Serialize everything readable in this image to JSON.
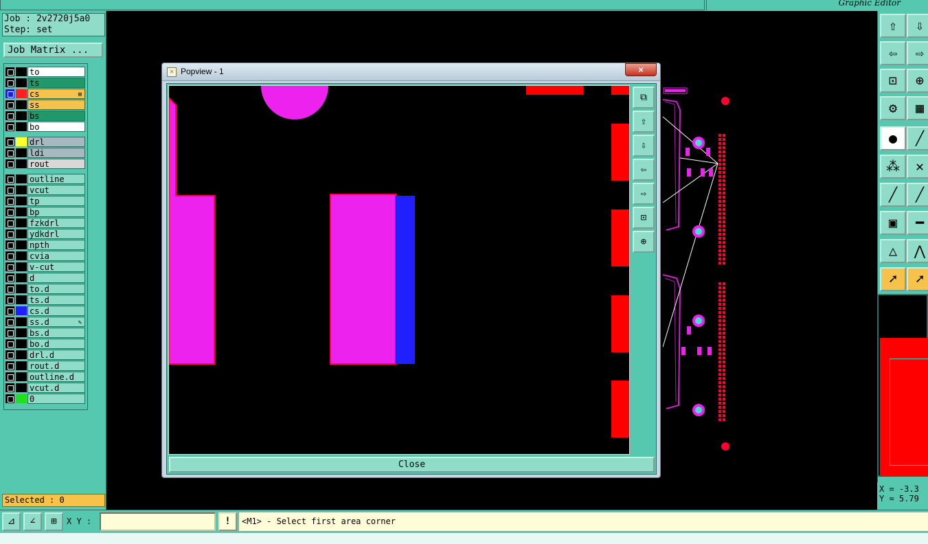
{
  "app": {
    "title": "Graphic Editor"
  },
  "job": {
    "name_line": "Job : 2v2720j5a0",
    "step_line": "Step: set",
    "matrix_button": "Job Matrix ..."
  },
  "layers": {
    "board": [
      {
        "name": "to",
        "swatch": "#000000",
        "bg": "#ffffff"
      },
      {
        "name": "ts",
        "swatch": "#000000",
        "bg": "#1e9a6a"
      },
      {
        "name": "cs",
        "swatch": "#ff2020",
        "bg": "#f7c24a",
        "selected": true,
        "mark": "⊞"
      },
      {
        "name": "ss",
        "swatch": "#000000",
        "bg": "#f7c24a"
      },
      {
        "name": "bs",
        "swatch": "#000000",
        "bg": "#1e9a6a"
      },
      {
        "name": "bo",
        "swatch": "#000000",
        "bg": "#ffffff"
      }
    ],
    "drill": [
      {
        "name": "drl",
        "swatch": "#ffff30",
        "bg": "#a8b8c0"
      },
      {
        "name": "ldi",
        "swatch": "#000000",
        "bg": "#a8b8c0"
      },
      {
        "name": "rout",
        "swatch": "#000000",
        "bg": "#d8d8d8"
      }
    ],
    "misc": [
      {
        "name": "outline",
        "swatch": "#000000"
      },
      {
        "name": "vcut",
        "swatch": "#000000"
      },
      {
        "name": "tp",
        "swatch": "#000000"
      },
      {
        "name": "bp",
        "swatch": "#000000"
      },
      {
        "name": "fzkdrl",
        "swatch": "#000000"
      },
      {
        "name": "ydkdrl",
        "swatch": "#000000"
      },
      {
        "name": "npth",
        "swatch": "#000000"
      },
      {
        "name": "cvia",
        "swatch": "#000000"
      },
      {
        "name": "v-cut",
        "swatch": "#000000"
      },
      {
        "name": "d",
        "swatch": "#000000"
      },
      {
        "name": "to.d",
        "swatch": "#000000"
      },
      {
        "name": "ts.d",
        "swatch": "#000000"
      },
      {
        "name": "cs.d",
        "swatch": "#2020ff"
      },
      {
        "name": "ss.d",
        "swatch": "#000000",
        "mark": "✎"
      },
      {
        "name": "bs.d",
        "swatch": "#000000"
      },
      {
        "name": "bo.d",
        "swatch": "#000000"
      },
      {
        "name": "drl.d",
        "swatch": "#000000"
      },
      {
        "name": "rout.d",
        "swatch": "#000000"
      },
      {
        "name": "outline.d",
        "swatch": "#000000"
      },
      {
        "name": "vcut.d",
        "swatch": "#000000"
      },
      {
        "name": "0",
        "swatch": "#20e020"
      }
    ]
  },
  "selected": "Selected : 0",
  "coords": {
    "x": "X = -3.3",
    "y": "Y = 5.79"
  },
  "bottom": {
    "xy_label": "X Y :",
    "xy_value": "",
    "excl": "!",
    "status": "<M1> - Select first area corner"
  },
  "popview": {
    "title": "Popview - 1",
    "close_x": "×",
    "close_button": "Close"
  },
  "right_tools": [
    {
      "icon": "zoom-home-icon",
      "glyph": "⇧"
    },
    {
      "icon": "pan-down-icon",
      "glyph": "⇩"
    },
    {
      "icon": "pan-left-icon",
      "glyph": "⇦"
    },
    {
      "icon": "pan-right-icon",
      "glyph": "⇨"
    },
    {
      "icon": "zoom-fit-icon",
      "glyph": "⊡"
    },
    {
      "icon": "zoom-center-icon",
      "glyph": "⊕"
    },
    {
      "icon": "measure-icon",
      "glyph": "⚙"
    },
    {
      "icon": "grid-icon",
      "glyph": "▦"
    },
    {
      "icon": "add-pad-icon",
      "glyph": "●"
    },
    {
      "icon": "add-line-icon",
      "glyph": "╱"
    },
    {
      "icon": "connect-icon",
      "glyph": "⁂"
    },
    {
      "icon": "cut-icon",
      "glyph": "✕"
    },
    {
      "icon": "draw-line-icon",
      "glyph": "╱"
    },
    {
      "icon": "draw-arc-icon",
      "glyph": "╱"
    },
    {
      "icon": "shape-icon",
      "glyph": "▣"
    },
    {
      "icon": "segment-icon",
      "glyph": "━"
    },
    {
      "icon": "triangle-icon",
      "glyph": "△"
    },
    {
      "icon": "polygon-icon",
      "glyph": "⋀"
    },
    {
      "icon": "select-icon",
      "glyph": "➚"
    },
    {
      "icon": "select-box-icon",
      "glyph": "➚"
    }
  ],
  "popview_tools": [
    {
      "icon": "popview-new-icon",
      "glyph": "⧉"
    },
    {
      "icon": "popview-pan-up-icon",
      "glyph": "⇧"
    },
    {
      "icon": "popview-pan-down-icon",
      "glyph": "⇩"
    },
    {
      "icon": "popview-pan-left-icon",
      "glyph": "⇦"
    },
    {
      "icon": "popview-pan-right-icon",
      "glyph": "⇨"
    },
    {
      "icon": "popview-zoom-fit-icon",
      "glyph": "⊡"
    },
    {
      "icon": "popview-zoom-center-icon",
      "glyph": "⊕"
    }
  ],
  "bottom_tools": [
    {
      "icon": "snap-icon",
      "glyph": "⊿"
    },
    {
      "icon": "angle-icon",
      "glyph": "∠"
    },
    {
      "icon": "grid-snap-icon",
      "glyph": "⊞"
    }
  ],
  "colors": {
    "panel": "#56c8b0",
    "copper": "#ee22ee",
    "pad_red": "#ff0000",
    "blue": "#2020ff",
    "highlight": "#f7c24a"
  }
}
